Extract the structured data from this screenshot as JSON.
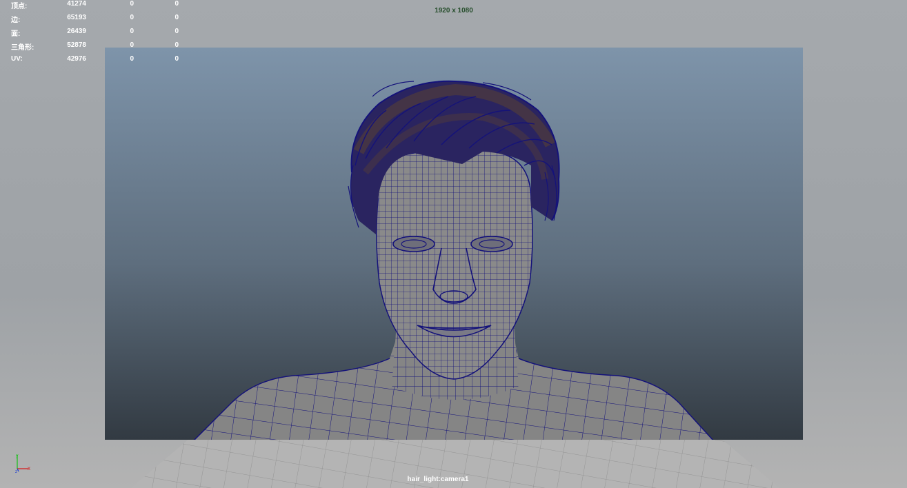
{
  "hud": {
    "stats": [
      {
        "label": "顶点:",
        "values": [
          "41274",
          "0",
          "0"
        ]
      },
      {
        "label": "边:",
        "values": [
          "65193",
          "0",
          "0"
        ]
      },
      {
        "label": "面:",
        "values": [
          "26439",
          "0",
          "0"
        ]
      },
      {
        "label": "三角形:",
        "values": [
          "52878",
          "0",
          "0"
        ]
      },
      {
        "label": "UV:",
        "values": [
          "42976",
          "0",
          "0"
        ]
      }
    ]
  },
  "viewport": {
    "resolution_gate_label": "1920 x 1080",
    "camera_name": "hair_light:camera1",
    "wireframe_color": "#14127a",
    "mesh_color": "#808080",
    "hair_color": "#5a4232"
  },
  "axis_gizmo": {
    "icon": "axis-gizmo-icon",
    "x_color": "#d42020",
    "y_color": "#20c020",
    "z_color": "#2040d0"
  }
}
